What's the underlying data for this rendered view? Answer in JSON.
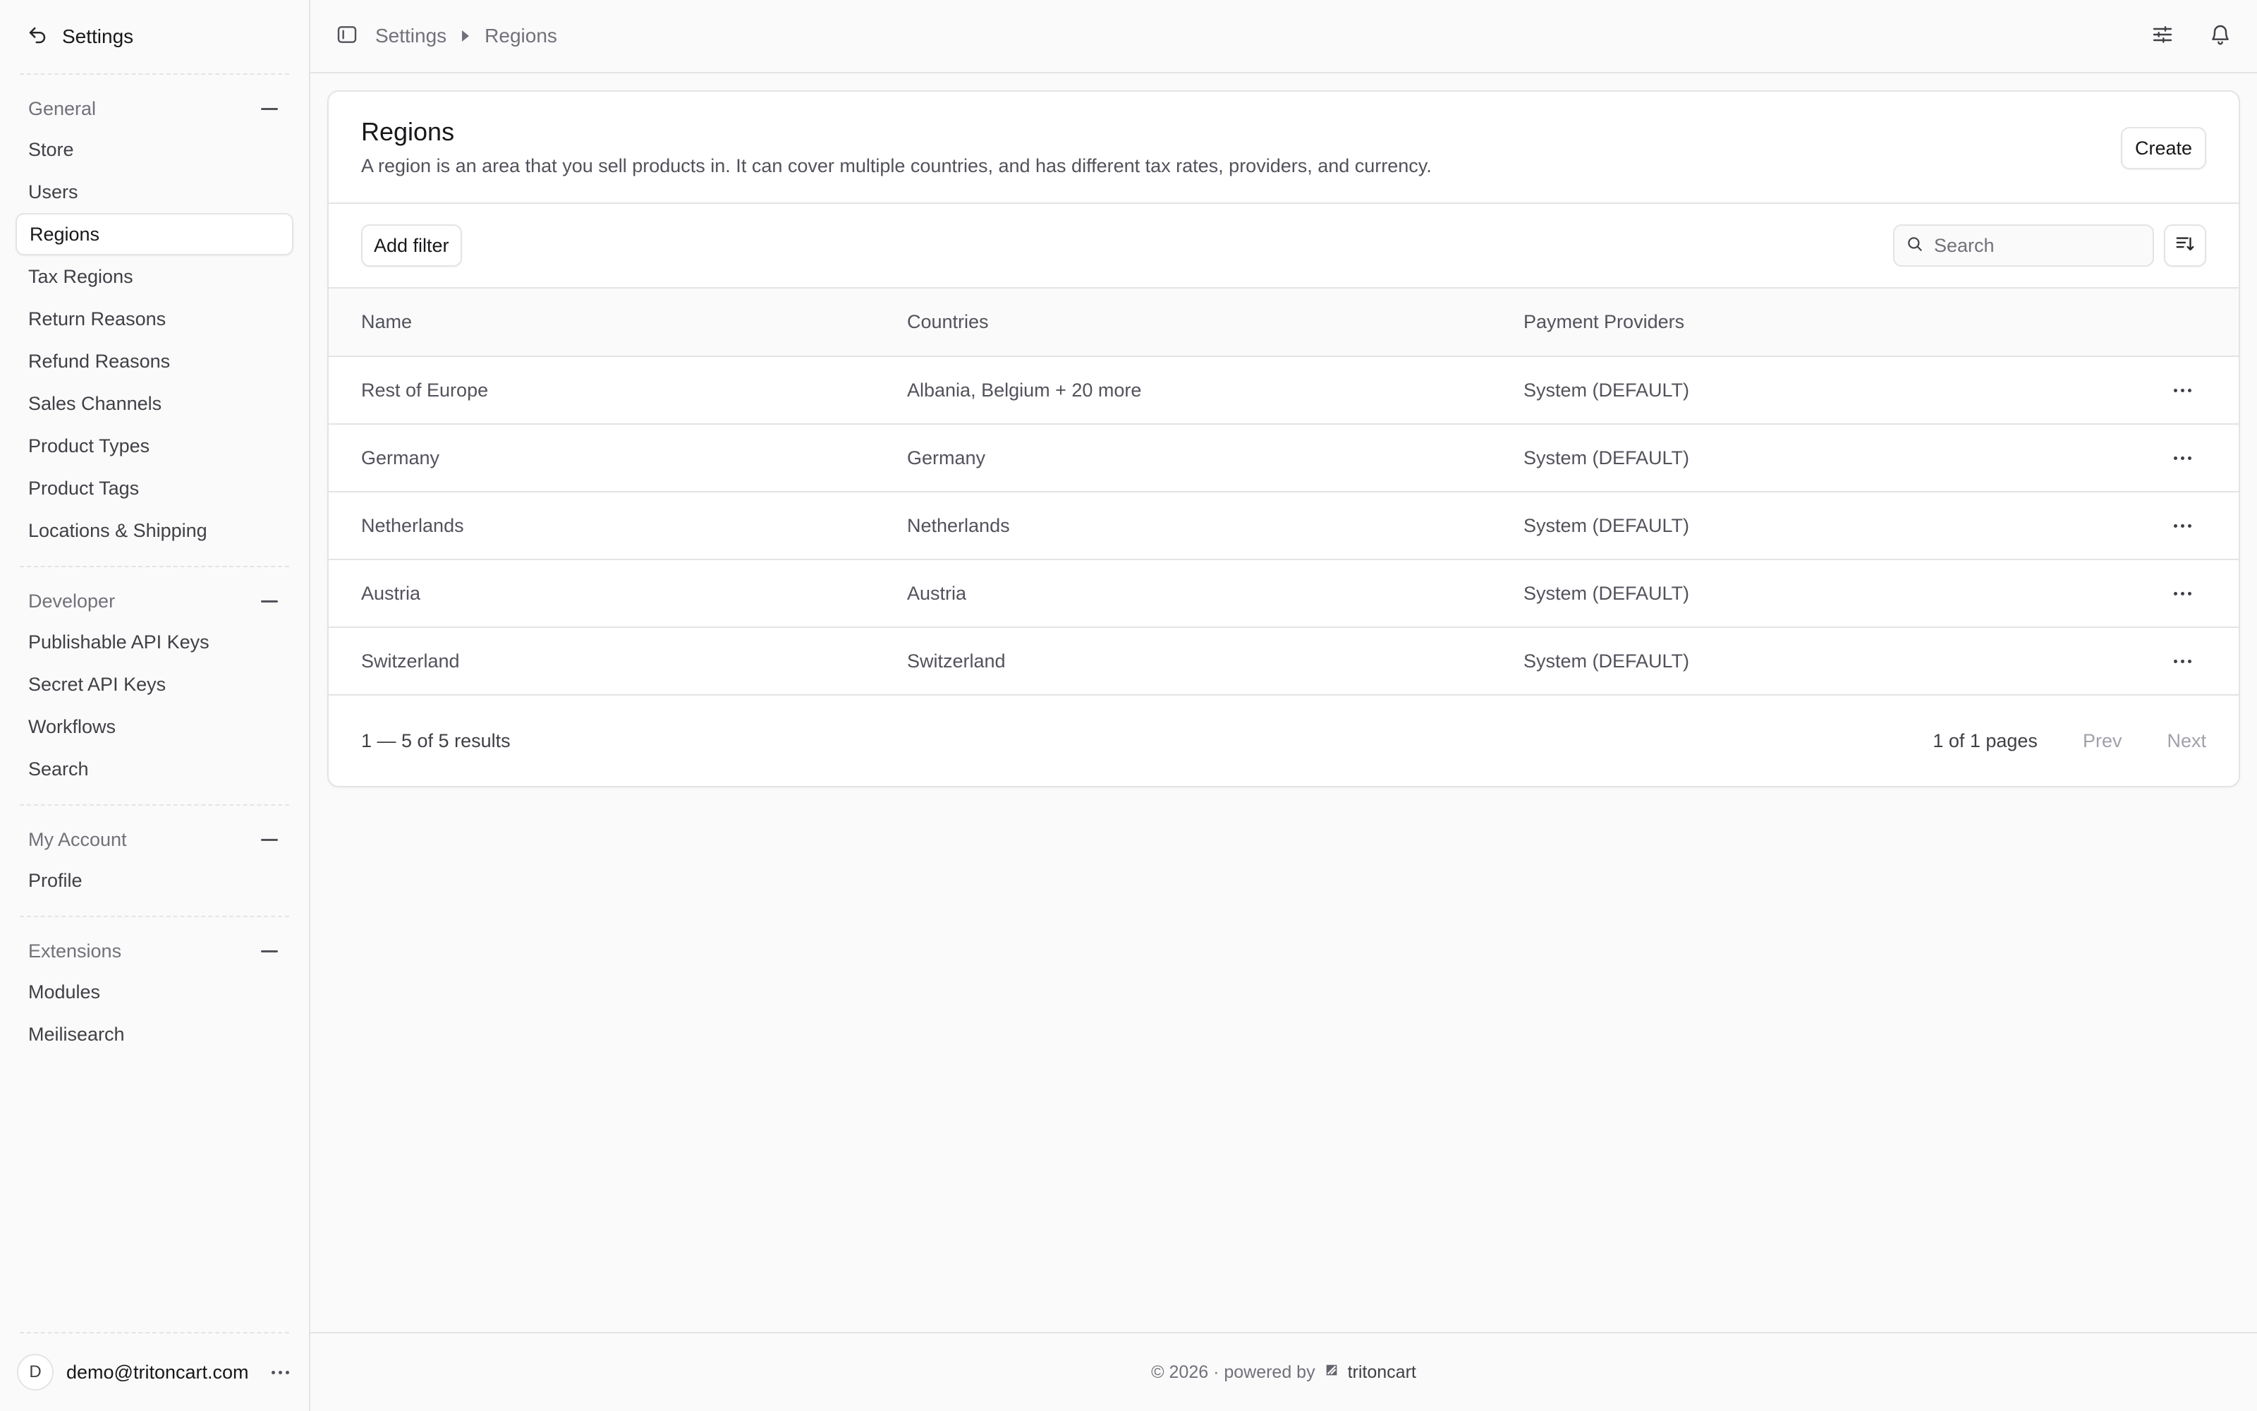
{
  "sidebar": {
    "title": "Settings",
    "sections": [
      {
        "label": "General",
        "items": [
          "Store",
          "Users",
          "Regions",
          "Tax Regions",
          "Return Reasons",
          "Refund Reasons",
          "Sales Channels",
          "Product Types",
          "Product Tags",
          "Locations & Shipping"
        ]
      },
      {
        "label": "Developer",
        "items": [
          "Publishable API Keys",
          "Secret API Keys",
          "Workflows",
          "Search"
        ]
      },
      {
        "label": "My Account",
        "items": [
          "Profile"
        ]
      },
      {
        "label": "Extensions",
        "items": [
          "Modules",
          "Meilisearch"
        ]
      }
    ],
    "active_item": "Regions",
    "user": {
      "initial": "D",
      "email": "demo@tritoncart.com"
    }
  },
  "topbar": {
    "breadcrumb": [
      "Settings",
      "Regions"
    ]
  },
  "page": {
    "title": "Regions",
    "description": "A region is an area that you sell products in. It can cover multiple countries, and has different tax rates, providers, and currency.",
    "create_label": "Create",
    "add_filter_label": "Add filter",
    "search_placeholder": "Search"
  },
  "table": {
    "columns": [
      "Name",
      "Countries",
      "Payment Providers"
    ],
    "rows": [
      [
        "Rest of Europe",
        "Albania, Belgium + 20 more",
        "System (DEFAULT)"
      ],
      [
        "Germany",
        "Germany",
        "System (DEFAULT)"
      ],
      [
        "Netherlands",
        "Netherlands",
        "System (DEFAULT)"
      ],
      [
        "Austria",
        "Austria",
        "System (DEFAULT)"
      ],
      [
        "Switzerland",
        "Switzerland",
        "System (DEFAULT)"
      ]
    ]
  },
  "pagination": {
    "results": "1 — 5 of 5 results",
    "pages": "1 of 1 pages",
    "prev": "Prev",
    "next": "Next"
  },
  "footer": {
    "text": "© 2026 · powered by",
    "brand": "tritoncart"
  },
  "icons": {
    "back": "back-arrow-icon",
    "sidebar_toggle": "sidebar-toggle-icon",
    "settings_sliders": "sliders-icon",
    "notifications": "bell-icon",
    "search": "search-icon",
    "sort": "sort-icon",
    "row_menu": "ellipsis-icon"
  }
}
